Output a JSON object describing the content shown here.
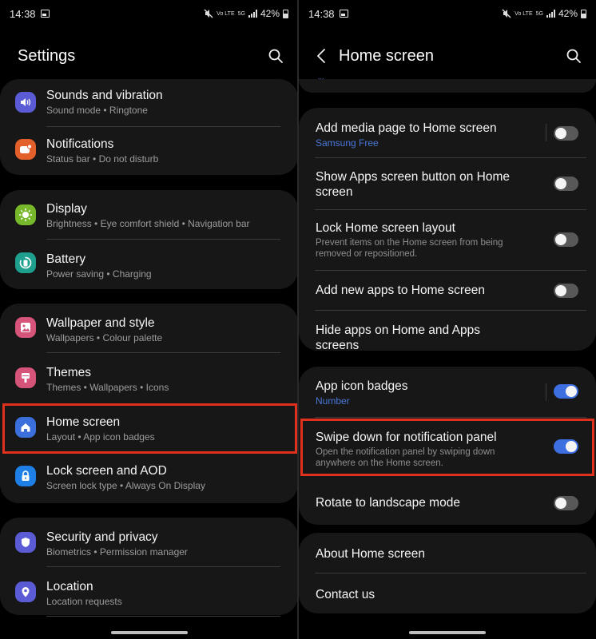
{
  "status_bar": {
    "time": "14:38",
    "volte_label": "Vo LTE",
    "network_label": "5G",
    "battery_percent": "42%"
  },
  "left": {
    "title": "Settings",
    "groups": [
      {
        "items": [
          {
            "title": "Sounds and vibration",
            "subtitle": "Sound mode  •  Ringtone",
            "icon": "speaker-icon",
            "color": "#5b5bd6"
          },
          {
            "title": "Notifications",
            "subtitle": "Status bar  •  Do not disturb",
            "icon": "notification-icon",
            "color": "#e4602b"
          }
        ]
      },
      {
        "items": [
          {
            "title": "Display",
            "subtitle": "Brightness  •  Eye comfort shield  •  Navigation bar",
            "icon": "brightness-icon",
            "color": "#76b82a"
          },
          {
            "title": "Battery",
            "subtitle": "Power saving  •  Charging",
            "icon": "battery-icon",
            "color": "#1fa08f"
          }
        ]
      },
      {
        "items": [
          {
            "title": "Wallpaper and style",
            "subtitle": "Wallpapers  •  Colour palette",
            "icon": "wallpaper-icon",
            "color": "#d6537a"
          },
          {
            "title": "Themes",
            "subtitle": "Themes  •  Wallpapers  •  Icons",
            "icon": "themes-brush-icon",
            "color": "#d6537a"
          },
          {
            "title": "Home screen",
            "subtitle": "Layout  •  App icon badges",
            "icon": "home-icon",
            "color": "#3b6fdc"
          },
          {
            "title": "Lock screen and AOD",
            "subtitle": "Screen lock type  •  Always On Display",
            "icon": "lock-icon",
            "color": "#1e7fe6"
          }
        ]
      },
      {
        "items": [
          {
            "title": "Security and privacy",
            "subtitle": "Biometrics  •  Permission manager",
            "icon": "shield-icon",
            "color": "#5b5bd6"
          },
          {
            "title": "Location",
            "subtitle": "Location requests",
            "icon": "location-pin-icon",
            "color": "#5b5bd6"
          }
        ]
      }
    ],
    "highlighted_item": "Home screen"
  },
  "right": {
    "title": "Home screen",
    "partial_top_text": "...",
    "group1": [
      {
        "title": "Add media page to Home screen",
        "subtitle": "Samsung Free",
        "toggle": false,
        "has_divider": true
      },
      {
        "title": "Show Apps screen button on Home screen",
        "toggle": false
      },
      {
        "title": "Lock Home screen layout",
        "description": "Prevent items on the Home screen from being removed or repositioned.",
        "toggle": false
      },
      {
        "title": "Add new apps to Home screen",
        "toggle": false
      },
      {
        "title": "Hide apps on Home and Apps screens"
      }
    ],
    "group2": [
      {
        "title": "App icon badges",
        "subtitle": "Number",
        "toggle": true,
        "has_divider": true
      },
      {
        "title": "Swipe down for notification panel",
        "description": "Open the notification panel by swiping down anywhere on the Home screen.",
        "toggle": true
      },
      {
        "title": "Rotate to landscape mode",
        "toggle": false
      }
    ],
    "group3": [
      {
        "title": "About Home screen"
      },
      {
        "title": "Contact us"
      }
    ],
    "highlighted_item": "Swipe down for notification panel"
  },
  "colors": {
    "accent_blue": "#3e6fe0",
    "highlight_red": "#e0301e",
    "card_bg": "#171717"
  }
}
